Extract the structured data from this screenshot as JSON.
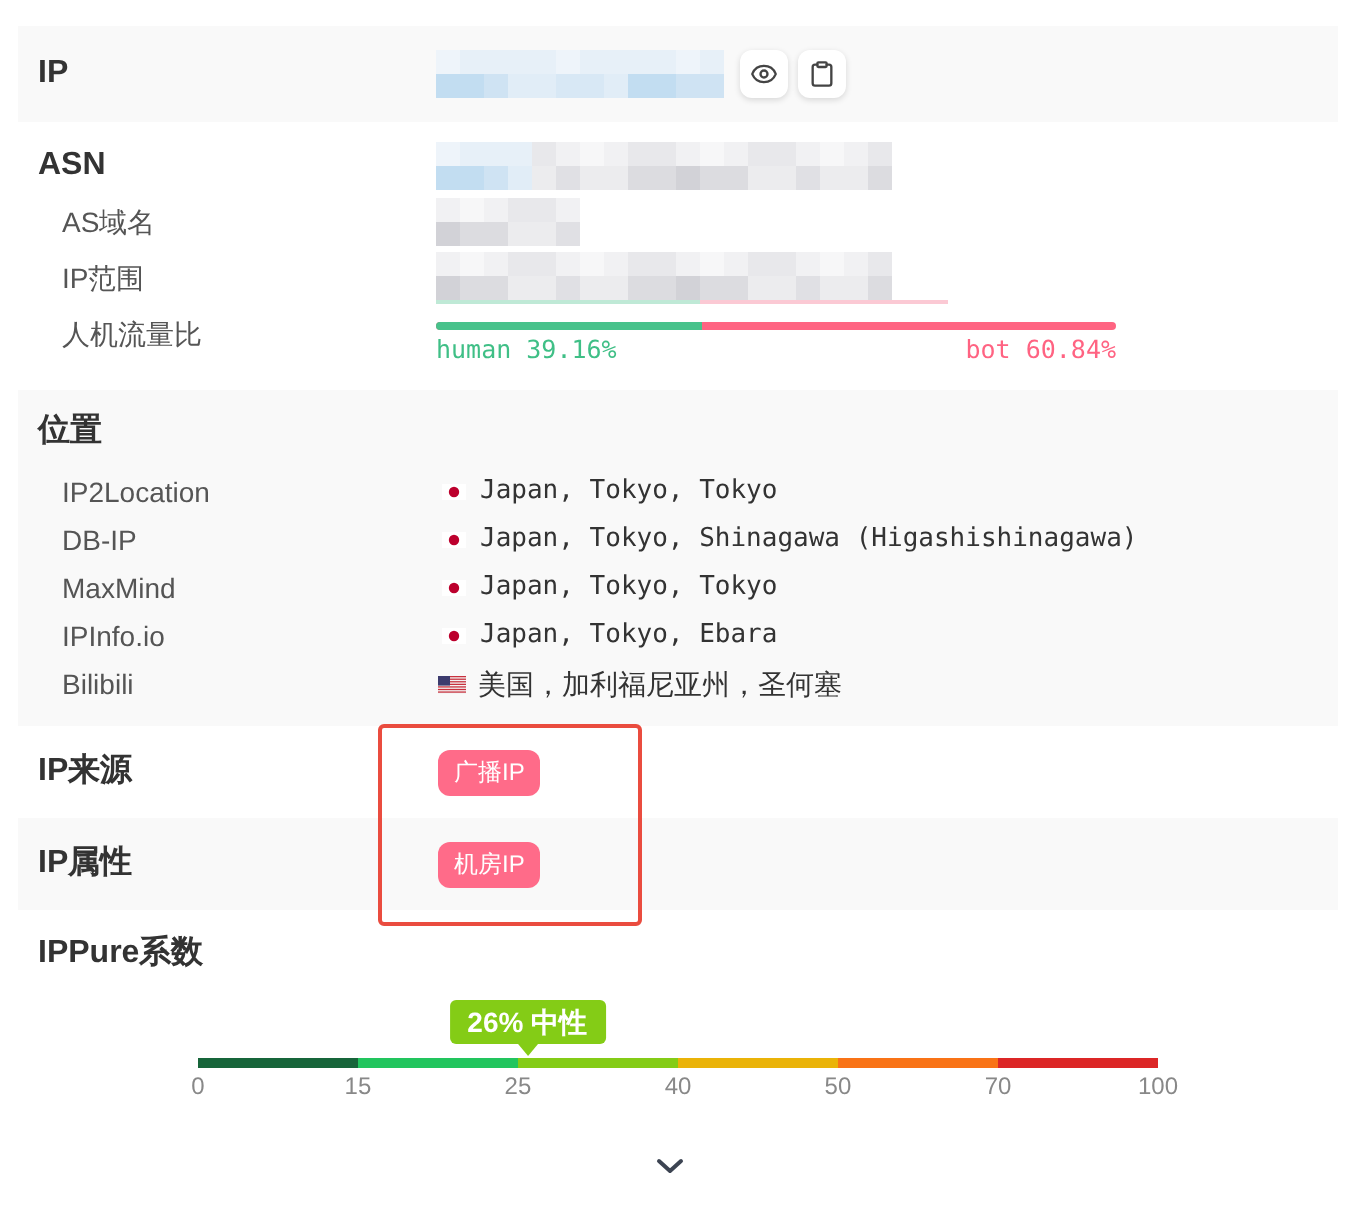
{
  "sections": [
    {
      "kind": "ip",
      "label": "IP"
    },
    {
      "kind": "asn",
      "label": "ASN",
      "rows": [
        {
          "kind": "hidden",
          "label": "AS域名"
        },
        {
          "kind": "hidden",
          "label": "IP范围"
        },
        {
          "kind": "ratio",
          "label": "人机流量比",
          "level": 0.3916,
          "human": "human 39.16%",
          "bot": "bot 60.84%"
        }
      ]
    },
    {
      "kind": "location",
      "label": "位置",
      "rows": [
        {
          "kind": "japan",
          "source": "IP2Location",
          "place": "Japan, Tokyo, Tokyo"
        },
        {
          "kind": "japan",
          "source": "DB-IP",
          "place": "Japan, Tokyo, Shinagawa (Higashishinagawa)"
        },
        {
          "kind": "japan",
          "source": "MaxMind",
          "place": "Japan, Tokyo, Tokyo"
        },
        {
          "kind": "japan",
          "source": "IPInfo.io",
          "place": "Japan, Tokyo, Ebara"
        },
        {
          "kind": "usa",
          "source": "Bilibili",
          "place": "美国，加利福尼亚州，圣何塞"
        }
      ]
    },
    {
      "kind": "tags",
      "label": "IP来源",
      "tags": [
        "广播IP"
      ]
    },
    {
      "kind": "tags",
      "label": "IP属性",
      "tags": [
        "机房IP"
      ]
    },
    {
      "kind": "score",
      "label": "IPPure系数",
      "scale": {
        "ticks": [
          "0",
          "15",
          "25",
          "40",
          "50",
          "70",
          "100"
        ],
        "segments": [
          {
            "color": "#17653a"
          },
          {
            "color": "#22c55e"
          },
          {
            "color": "#84cc16"
          },
          {
            "color": "#eab308"
          },
          {
            "color": "#f97316"
          },
          {
            "color": "#dc2626"
          }
        ],
        "marker": {
          "label": "26% 中性",
          "level": 0.343
        }
      }
    }
  ],
  "tags_highlighted": true
}
